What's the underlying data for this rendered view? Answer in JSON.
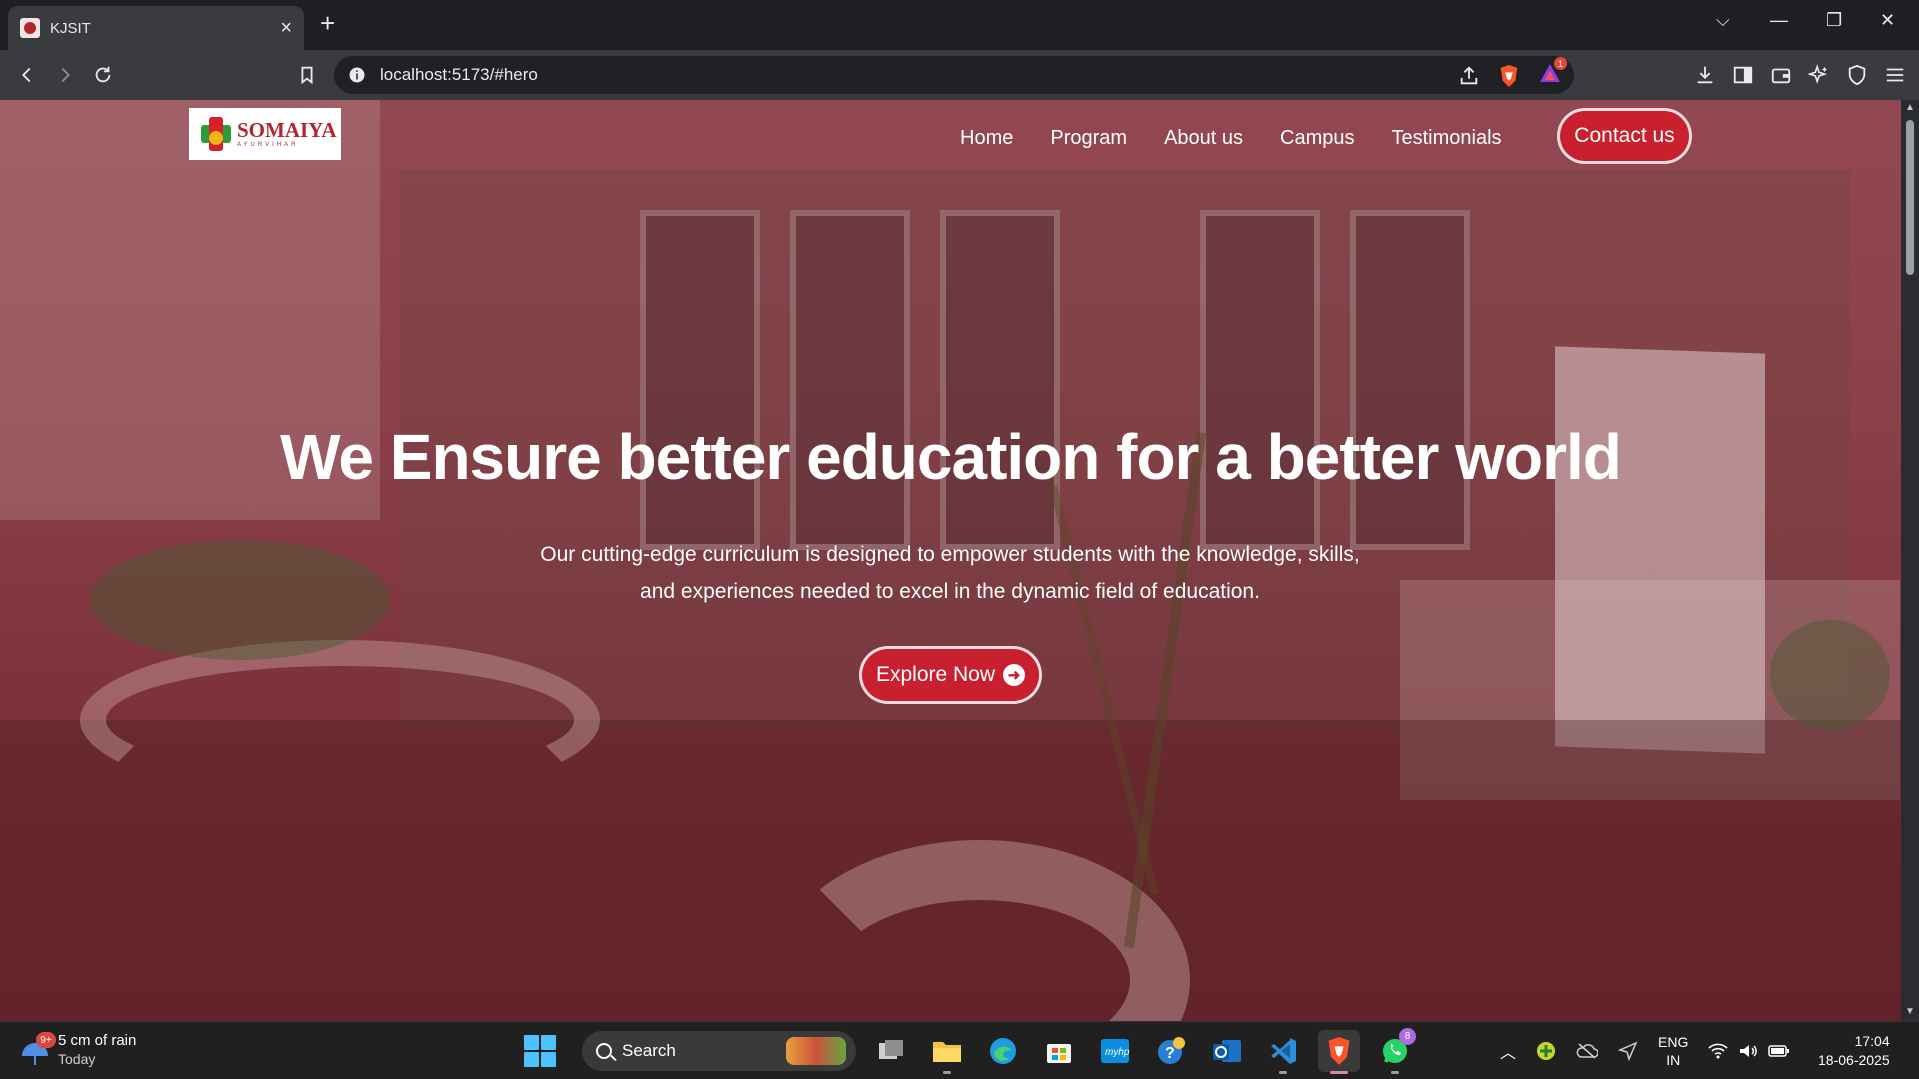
{
  "browser": {
    "tab_title": "KJSIT",
    "url": "localhost:5173/#hero",
    "notification_count": "1"
  },
  "site": {
    "logo_name": "SOMAIYA",
    "logo_sub": "AYURVIHAR",
    "nav": [
      "Home",
      "Program",
      "About us",
      "Campus",
      "Testimonials"
    ],
    "contact_label": "Contact us",
    "hero_title": "We Ensure better education for a better world",
    "hero_description": "Our cutting-edge curriculum is designed to empower students with the knowledge, skills, and experiences needed to excel in the dynamic field of education.",
    "explore_label": "Explore Now"
  },
  "taskbar": {
    "weather_badge": "9+",
    "weather_text": "5 cm of rain",
    "weather_sub": "Today",
    "search_label": "Search",
    "whatsapp_badge": "8",
    "lang_top": "ENG",
    "lang_bottom": "IN",
    "time": "17:04",
    "date": "18-06-2025"
  },
  "colors": {
    "accent": "#c8202f",
    "overlay": "#8c1e32",
    "windows_blue": "#4cc2ff"
  }
}
